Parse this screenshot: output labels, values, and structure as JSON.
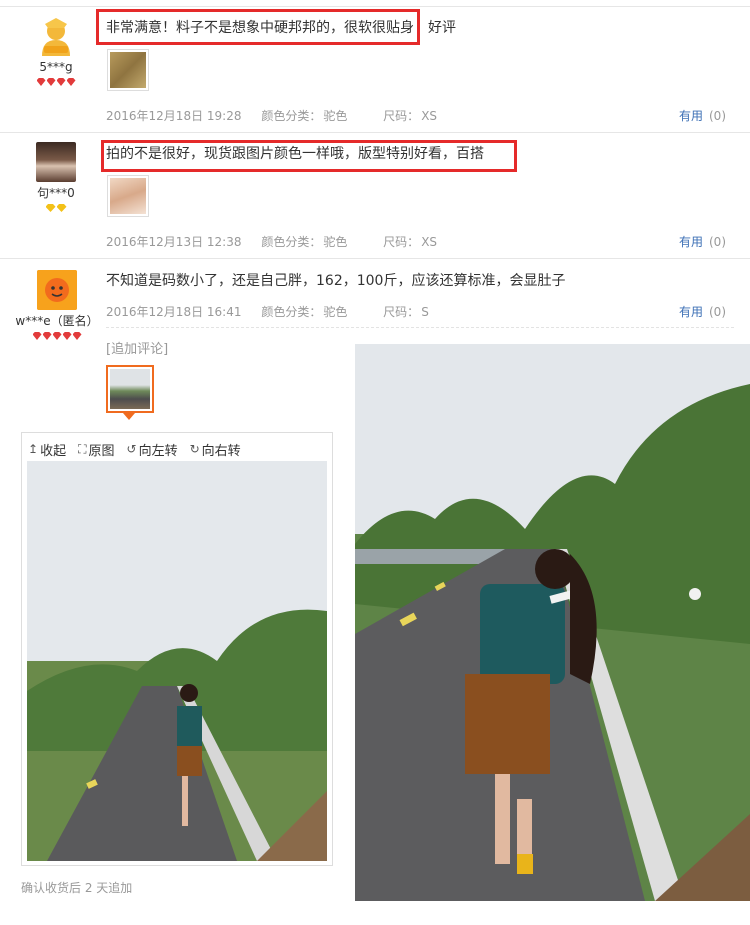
{
  "reviews": [
    {
      "username": "5***g",
      "vip_badge": "会员用户",
      "gem_type": "red",
      "gems": 4,
      "content": "非常满意！料子不是想象中硬邦邦的，很软很贴身",
      "extra": "好评",
      "date": "2016年12月18日 19:28",
      "color_label": "颜色分类：",
      "color_value": "驼色",
      "size_label": "尺码：",
      "size_value": "XS",
      "useful_label": "有用",
      "useful_count": "(0)"
    },
    {
      "username": "句***0",
      "gem_type": "yellow",
      "gems": 2,
      "content": "拍的不是很好，现货跟图片颜色一样哦，版型特别好看，百搭",
      "date": "2016年12月13日 12:38",
      "color_label": "颜色分类：",
      "color_value": "驼色",
      "size_label": "尺码：",
      "size_value": "XS",
      "useful_label": "有用",
      "useful_count": "(0)"
    },
    {
      "username": "w***e（匿名）",
      "gem_type": "red",
      "gems": 5,
      "content": "不知道是码数小了，还是自己胖，162，100斤，应该还算标准，会显肚子",
      "date": "2016年12月18日 16:41",
      "color_label": "颜色分类：",
      "color_value": "驼色",
      "size_label": "尺码：",
      "size_value": "S",
      "useful_label": "有用",
      "useful_count": "(0)",
      "append_label": "[追加评论]",
      "append_note": "确认收货后 2 天追加"
    }
  ],
  "viewer": {
    "collapse": "收起",
    "original": "原图",
    "rotate_left": "向左转",
    "rotate_right": "向右转"
  },
  "colors": {
    "highlight": "#e52a2a",
    "link": "#3c6fb5",
    "accent": "#f06b1f"
  }
}
